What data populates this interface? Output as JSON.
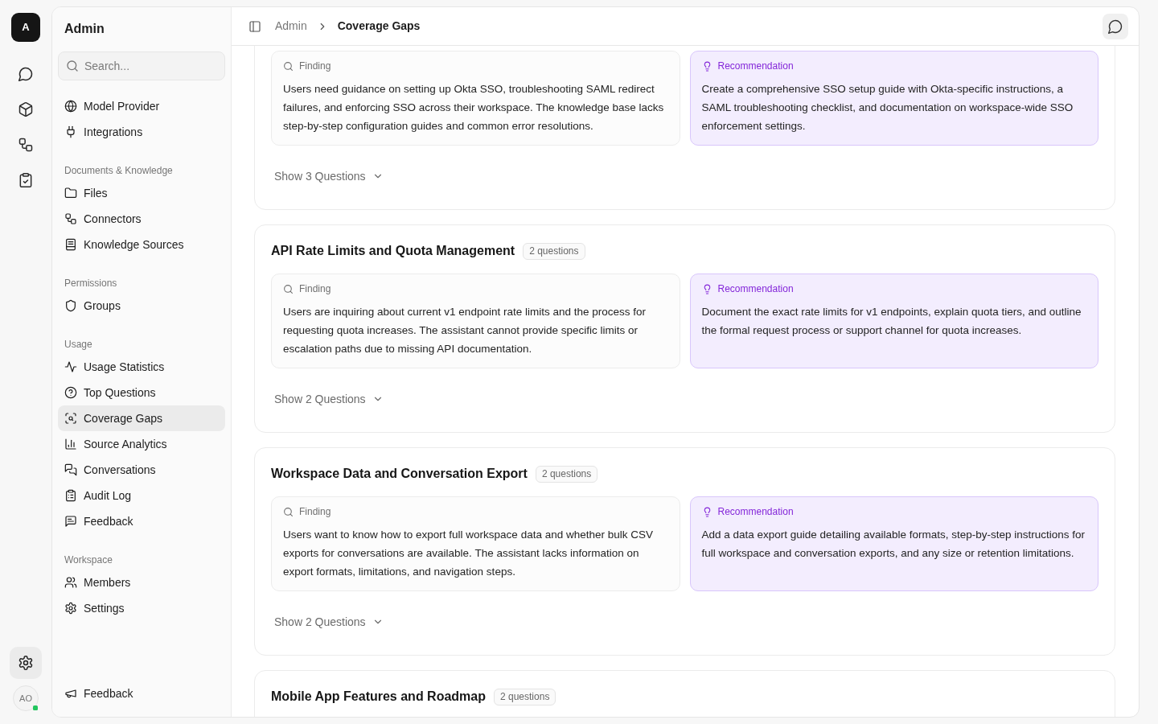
{
  "rail": {
    "logo": "A",
    "settings_button": {
      "selected": true
    },
    "avatar": {
      "initials": "AO",
      "online": true
    }
  },
  "sidebar": {
    "title": "Admin",
    "search": {
      "placeholder": "Search..."
    },
    "sections": [
      {
        "items": [
          {
            "label": "Model Provider",
            "selected": false
          },
          {
            "label": "Integrations",
            "selected": false
          }
        ]
      },
      {
        "heading": "Documents & Knowledge",
        "items": [
          {
            "label": "Files",
            "selected": false
          },
          {
            "label": "Connectors",
            "selected": false
          },
          {
            "label": "Knowledge Sources",
            "selected": false
          }
        ]
      },
      {
        "heading": "Permissions",
        "items": [
          {
            "label": "Groups",
            "selected": false
          }
        ]
      },
      {
        "heading": "Usage",
        "items": [
          {
            "label": "Usage Statistics",
            "selected": false
          },
          {
            "label": "Top Questions",
            "selected": false
          },
          {
            "label": "Coverage Gaps",
            "selected": true
          },
          {
            "label": "Source Analytics",
            "selected": false
          },
          {
            "label": "Conversations",
            "selected": false
          },
          {
            "label": "Audit Log",
            "selected": false
          },
          {
            "label": "Feedback",
            "selected": false
          }
        ]
      },
      {
        "heading": "Workspace",
        "items": [
          {
            "label": "Members",
            "selected": false
          },
          {
            "label": "Settings",
            "selected": false
          }
        ]
      }
    ],
    "footer_item": {
      "label": "Feedback"
    }
  },
  "header": {
    "breadcrumb": [
      "Admin",
      "Coverage Gaps"
    ]
  },
  "gaps": [
    {
      "finding": {
        "label": "Finding",
        "text": "Users need guidance on setting up Okta SSO, troubleshooting SAML redirect failures, and enforcing SSO across their workspace. The knowledge base lacks step-by-step configuration guides and common error resolutions."
      },
      "recommendation": {
        "label": "Recommendation",
        "text": "Create a comprehensive SSO setup guide with Okta-specific instructions, a SAML troubleshooting checklist, and documentation on workspace-wide SSO enforcement settings."
      },
      "toggle": {
        "label": "Show 3 Questions",
        "expanded": false
      }
    },
    {
      "title": "API Rate Limits and Quota Management",
      "count": "2 questions",
      "finding": {
        "label": "Finding",
        "text": "Users are inquiring about current v1 endpoint rate limits and the process for requesting quota increases. The assistant cannot provide specific limits or escalation paths due to missing API documentation."
      },
      "recommendation": {
        "label": "Recommendation",
        "text": "Document the exact rate limits for v1 endpoints, explain quota tiers, and outline the formal request process or support channel for quota increases."
      },
      "toggle": {
        "label": "Show 2 Questions",
        "expanded": false
      }
    },
    {
      "title": "Workspace Data and Conversation Export",
      "count": "2 questions",
      "finding": {
        "label": "Finding",
        "text": "Users want to know how to export full workspace data and whether bulk CSV exports for conversations are available. The assistant lacks information on export formats, limitations, and navigation steps."
      },
      "recommendation": {
        "label": "Recommendation",
        "text": "Add a data export guide detailing available formats, step-by-step instructions for full workspace and conversation exports, and any size or retention limitations."
      },
      "toggle": {
        "label": "Show 2 Questions",
        "expanded": false
      }
    },
    {
      "title": "Mobile App Features and Roadmap",
      "count": "2 questions"
    }
  ]
}
